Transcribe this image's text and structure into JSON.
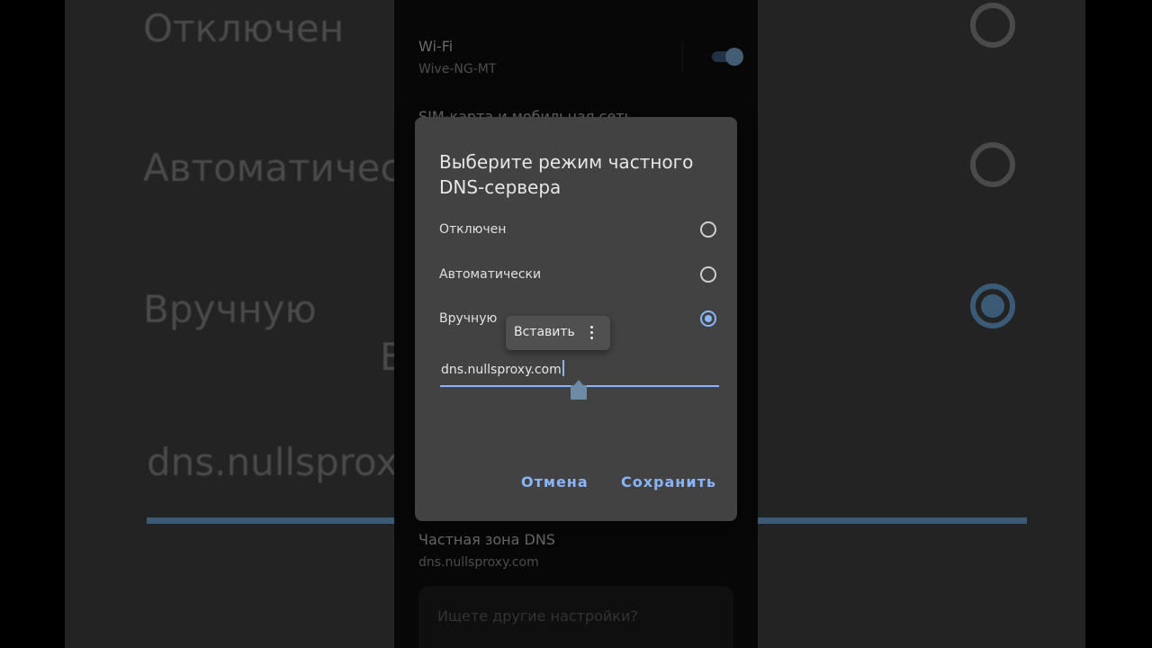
{
  "background": {
    "option_off": "Отключен",
    "option_auto": "Автоматичес",
    "option_manual": "Вручную",
    "dialog_fragment": "В",
    "hostname_fragment": "dns.nullsprox"
  },
  "settings": {
    "wifi": {
      "title": "Wi-Fi",
      "subtitle": "Wive-NG-MT",
      "enabled": true
    },
    "sim_row": {
      "title": "SIM-карта и мобильная сеть"
    },
    "private_dns": {
      "title": "Частная зона DNS",
      "subtitle": "dns.nullsproxy.com"
    },
    "search": {
      "placeholder": "Ищете другие настройки?"
    }
  },
  "dialog": {
    "title": "Выберите режим частного DNS-сервера",
    "options": [
      {
        "label": "Отключен",
        "selected": false
      },
      {
        "label": "Автоматически",
        "selected": false
      },
      {
        "label": "Вручную",
        "selected": true
      }
    ],
    "hostname_value": "dns.nullsproxy.com",
    "paste_popup": {
      "label": "Вставить",
      "more_icon": "more-vert-icon"
    },
    "cancel_label": "Отмена",
    "save_label": "Сохранить"
  },
  "colors": {
    "accent": "#8ab4f8",
    "dialog_bg": "#424242",
    "screen_bg": "#0e0e0e"
  }
}
